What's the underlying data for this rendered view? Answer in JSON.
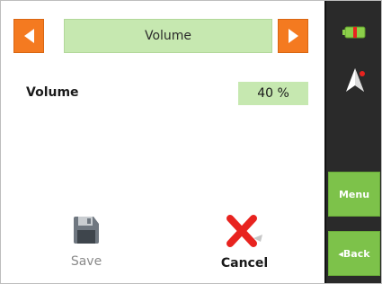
{
  "header": {
    "title": "Volume",
    "prev_icon": "chevron-left-icon",
    "next_icon": "chevron-right-icon"
  },
  "setting": {
    "label": "Volume",
    "value": "40 %",
    "value_percent": 40
  },
  "actions": {
    "save_label": "Save",
    "save_icon": "floppy-disk-icon",
    "cancel_label": "Cancel",
    "cancel_icon": "red-x-icon"
  },
  "sidebar": {
    "battery_icon": "battery-icon",
    "nav_icon": "compass-arrow-icon",
    "menu_label": "Menu",
    "back_label": "◂Back"
  },
  "colors": {
    "accent_orange": "#f47a20",
    "highlight_green": "#c6e8b0",
    "sidebar_button_green": "#7dc24a",
    "sidebar_bg": "#2a2a2a",
    "cancel_red": "#e8231f"
  }
}
